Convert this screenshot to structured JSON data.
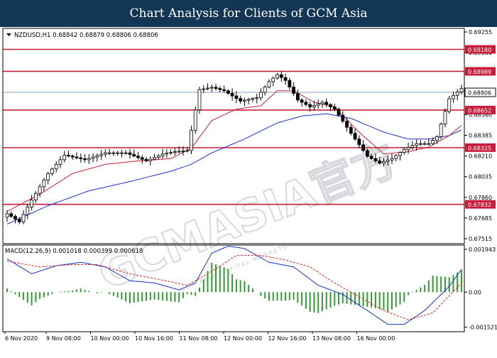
{
  "header": {
    "title": "Chart Analysis for Clients of GCM Asia"
  },
  "watermark": {
    "main": "GCMASIA官方",
    "sub": "GCM ASIA CAPITAL MARKETS"
  },
  "colors": {
    "level_line": "#c81e3c",
    "ma_fast": "#d02030",
    "ma_slow": "#1a2fd8",
    "macd_line": "#1a2fd8",
    "signal_line": "#e02020",
    "histogram": "#2e9e2e",
    "label_bg": "#c81e3c",
    "current_price_line": "#8aa4bf",
    "candle": "#000000"
  },
  "chart_data": [
    {
      "type": "candlestick",
      "symbol_info": "NZDUSD,H1  0.68842 0.68879 0.68806 0.68806",
      "ylim": [
        0.6749,
        0.6935
      ],
      "y_ticks": [
        "0.69255",
        "0.69080",
        "0.68905",
        "0.68735",
        "0.68560",
        "0.68385",
        "0.68210",
        "0.68035",
        "0.67860",
        "0.67685",
        "0.67515"
      ],
      "x_ticks": [
        "6 Nov 2020",
        "9 Nov 08:00",
        "10 Nov 00:00",
        "10 Nov 16:00",
        "11 Nov 08:00",
        "12 Nov 00:00",
        "12 Nov 16:00",
        "13 Nov 08:00",
        "16 Nov 00:00"
      ],
      "levels": [
        {
          "label": "0.69180",
          "value": 0.6918
        },
        {
          "label": "0.68989",
          "value": 0.68989
        },
        {
          "label": "0.68652",
          "value": 0.68652
        },
        {
          "label": "0.68325",
          "value": 0.68325
        },
        {
          "label": "0.67832",
          "value": 0.67832
        }
      ],
      "current_price": {
        "label": "0.68806",
        "value": 0.68806
      },
      "anchors": [
        [
          0,
          0.6775
        ],
        [
          3,
          0.6768
        ],
        [
          6,
          0.6787
        ],
        [
          10,
          0.681
        ],
        [
          14,
          0.6826
        ],
        [
          19,
          0.6822
        ],
        [
          24,
          0.6828
        ],
        [
          29,
          0.6828
        ],
        [
          34,
          0.6821
        ],
        [
          38,
          0.6827
        ],
        [
          41,
          0.6829
        ],
        [
          44,
          0.683
        ],
        [
          47,
          0.6883
        ],
        [
          50,
          0.6885
        ],
        [
          53,
          0.6882
        ],
        [
          57,
          0.6873
        ],
        [
          61,
          0.6876
        ],
        [
          64,
          0.689
        ],
        [
          66,
          0.6896
        ],
        [
          68,
          0.6891
        ],
        [
          71,
          0.6874
        ],
        [
          74,
          0.6868
        ],
        [
          77,
          0.6872
        ],
        [
          80,
          0.6866
        ],
        [
          84,
          0.6845
        ],
        [
          88,
          0.6825
        ],
        [
          91,
          0.6819
        ],
        [
          94,
          0.6823
        ],
        [
          97,
          0.6831
        ],
        [
          100,
          0.6836
        ],
        [
          103,
          0.6836
        ],
        [
          105,
          0.6842
        ],
        [
          108,
          0.6875
        ],
        [
          111,
          0.6884
        ]
      ],
      "ma_fast_anchors": [
        [
          0,
          0.6777
        ],
        [
          8,
          0.6792
        ],
        [
          16,
          0.681
        ],
        [
          24,
          0.6818
        ],
        [
          32,
          0.6821
        ],
        [
          40,
          0.6823
        ],
        [
          45,
          0.6832
        ],
        [
          50,
          0.6856
        ],
        [
          56,
          0.6866
        ],
        [
          62,
          0.6869
        ],
        [
          66,
          0.6882
        ],
        [
          70,
          0.6882
        ],
        [
          75,
          0.6872
        ],
        [
          80,
          0.6868
        ],
        [
          86,
          0.6846
        ],
        [
          92,
          0.6827
        ],
        [
          98,
          0.6829
        ],
        [
          103,
          0.6833
        ],
        [
          108,
          0.6843
        ],
        [
          111,
          0.6852
        ]
      ],
      "ma_slow_anchors": [
        [
          0,
          0.6766
        ],
        [
          10,
          0.6782
        ],
        [
          20,
          0.6795
        ],
        [
          30,
          0.6803
        ],
        [
          40,
          0.6812
        ],
        [
          45,
          0.6818
        ],
        [
          50,
          0.6828
        ],
        [
          58,
          0.684
        ],
        [
          66,
          0.6854
        ],
        [
          72,
          0.686
        ],
        [
          78,
          0.6862
        ],
        [
          84,
          0.6858
        ],
        [
          92,
          0.6846
        ],
        [
          98,
          0.684
        ],
        [
          103,
          0.684
        ],
        [
          108,
          0.6843
        ],
        [
          111,
          0.6848
        ]
      ]
    },
    {
      "type": "macd",
      "label": "MACD(12,26,9) 0.001018 0.000399 0.000618",
      "ylim": [
        -0.00172,
        0.00205
      ],
      "y_ticks": [
        {
          "label": "0.001943",
          "value": 0.001943
        },
        {
          "label": "0.00",
          "value": 0.0
        },
        {
          "label": "-0.001521",
          "value": -0.001521
        }
      ],
      "macd_anchors": [
        [
          0,
          0.00145
        ],
        [
          6,
          0.0008
        ],
        [
          12,
          0.00115
        ],
        [
          18,
          0.0013
        ],
        [
          24,
          0.0011
        ],
        [
          30,
          0.0005
        ],
        [
          36,
          0.0004
        ],
        [
          42,
          0.0001
        ],
        [
          46,
          0.0004
        ],
        [
          50,
          0.0017
        ],
        [
          54,
          0.002
        ],
        [
          58,
          0.0019
        ],
        [
          64,
          0.0013
        ],
        [
          70,
          0.0011
        ],
        [
          76,
          0.0003
        ],
        [
          82,
          -0.0001
        ],
        [
          88,
          -0.0008
        ],
        [
          93,
          -0.0014
        ],
        [
          97,
          -0.0014
        ],
        [
          102,
          -0.0008
        ],
        [
          108,
          0.00025
        ],
        [
          111,
          0.001
        ]
      ],
      "signal_anchors": [
        [
          0,
          0.00135
        ],
        [
          8,
          0.0011
        ],
        [
          16,
          0.0012
        ],
        [
          22,
          0.0012
        ],
        [
          30,
          0.0008
        ],
        [
          36,
          0.0006
        ],
        [
          44,
          0.0003
        ],
        [
          50,
          0.0009
        ],
        [
          56,
          0.0016
        ],
        [
          62,
          0.0016
        ],
        [
          68,
          0.0014
        ],
        [
          74,
          0.0011
        ],
        [
          80,
          0.0004
        ],
        [
          86,
          -0.0002
        ],
        [
          92,
          -0.0008
        ],
        [
          98,
          -0.0012
        ],
        [
          104,
          -0.0009
        ],
        [
          111,
          0.0004
        ]
      ]
    }
  ]
}
